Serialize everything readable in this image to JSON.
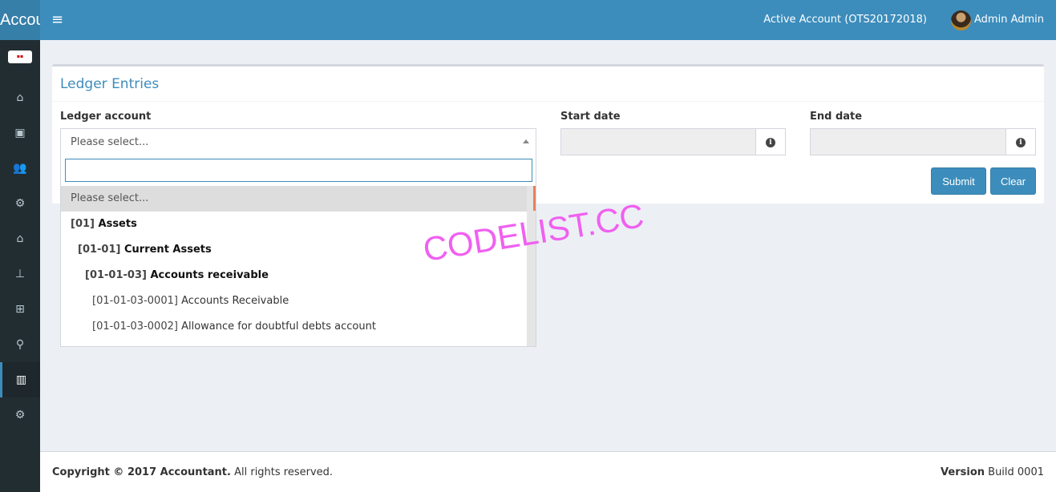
{
  "header": {
    "brand": "Accountant",
    "active_account": "Active Account (OTS20172018)",
    "user": "Admin Admin",
    "accent": "#3c8dbc"
  },
  "sidebar": {
    "items": [
      {
        "icon": "home-icon",
        "glyph": "⌂"
      },
      {
        "icon": "address-book-icon",
        "glyph": "▣"
      },
      {
        "icon": "users-icon",
        "glyph": "👥"
      },
      {
        "icon": "cogs-icon",
        "glyph": "⚙"
      },
      {
        "icon": "home-icon",
        "glyph": "⌂"
      },
      {
        "icon": "sitemap-icon",
        "glyph": "⊥"
      },
      {
        "icon": "plus-square-icon",
        "glyph": "⊞"
      },
      {
        "icon": "search-icon",
        "glyph": "⚲"
      },
      {
        "icon": "bar-chart-icon",
        "glyph": "▥",
        "active": true
      },
      {
        "icon": "gear-icon",
        "glyph": "⚙"
      }
    ]
  },
  "panel": {
    "title": "Ledger Entries",
    "ledger_label": "Ledger account",
    "placeholder": "Please select...",
    "options": [
      {
        "text": "Please select...",
        "selected": true
      },
      {
        "code": "[01]",
        "name": "Assets",
        "level": 0,
        "group": true
      },
      {
        "code": "[01-01]",
        "name": "Current Assets",
        "level": 1,
        "group": true
      },
      {
        "code": "[01-01-03]",
        "name": "Accounts receivable",
        "level": 2,
        "group": true
      },
      {
        "code": "[01-01-03-0001]",
        "name": "Accounts Receivable",
        "level": 3
      },
      {
        "code": "[01-01-03-0002]",
        "name": "Allowance for doubtful debts account",
        "level": 3
      }
    ],
    "start_label": "Start date",
    "start_value": "",
    "end_label": "End date",
    "end_value": "",
    "submit": "Submit",
    "clear": "Clear"
  },
  "footer": {
    "copyright": "Copyright © 2017 Accountant.",
    "rights": " All rights reserved.",
    "version_label": "Version",
    "build": " Build 0001"
  },
  "watermark": "CODELIST.CC"
}
